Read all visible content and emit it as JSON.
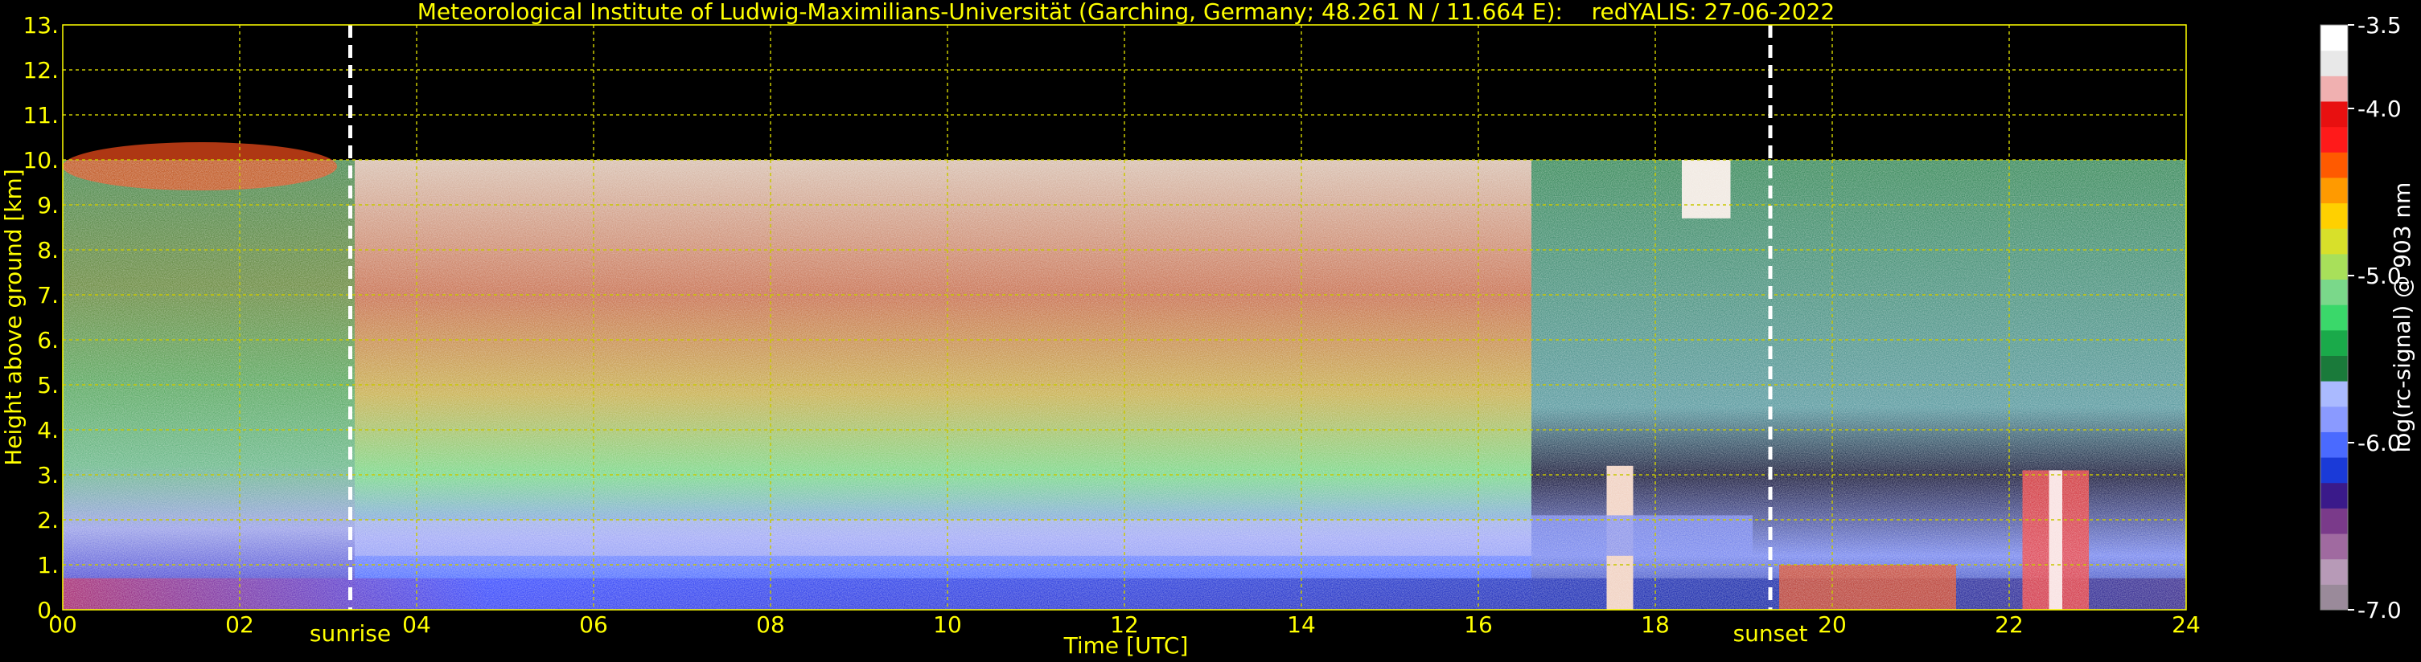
{
  "chart_data": {
    "type": "heatmap",
    "title": "Meteorological Institute of Ludwig-Maximilians-Universität (Garching, Germany; 48.261 N / 11.664 E):    redYALIS: 27-06-2022",
    "xlabel": "Time [UTC]",
    "ylabel": "Height above ground [km]",
    "xlim": [
      0,
      24
    ],
    "ylim": [
      0,
      13
    ],
    "x_ticks": [
      0,
      2,
      4,
      6,
      8,
      10,
      12,
      14,
      16,
      18,
      20,
      22,
      24
    ],
    "x_tick_labels": [
      "00",
      "02",
      "04",
      "06",
      "08",
      "10",
      "12",
      "14",
      "16",
      "18",
      "20",
      "22",
      "24"
    ],
    "y_ticks": [
      0,
      1,
      2,
      3,
      4,
      5,
      6,
      7,
      8,
      9,
      10,
      11,
      12,
      13
    ],
    "y_tick_labels": [
      "0.",
      "1.",
      "2.",
      "3.",
      "4.",
      "5.",
      "6.",
      "7.",
      "8.",
      "9.",
      "10.",
      "11.",
      "12.",
      "13."
    ],
    "grid": true,
    "grid_color": "#c8c800",
    "data_top_km": 10,
    "markers": [
      {
        "label": "sunrise",
        "x": 3.25
      },
      {
        "label": "sunset",
        "x": 19.3
      }
    ],
    "colorbar": {
      "label": "log(rc-signal) @ 903 nm",
      "range": [
        -7.0,
        -3.5
      ],
      "ticks": [
        -3.5,
        -4.0,
        -5.0,
        -6.0,
        -7.0
      ],
      "tick_labels": [
        "-3.5",
        "-4.0",
        "-5.0",
        "-6.0",
        "-7.0"
      ],
      "colors": [
        "#9a8a9a",
        "#b79ab7",
        "#a06aa0",
        "#7a3a8a",
        "#3a1a8a",
        "#1a3ad8",
        "#4a6aff",
        "#8a9aff",
        "#aabaff",
        "#1a7a3a",
        "#1aaa4a",
        "#3ad86a",
        "#7ad88a",
        "#a8e05a",
        "#d8e02a",
        "#ffd000",
        "#ff9a00",
        "#ff5a00",
        "#ff1a1a",
        "#e81010",
        "#f0b0b0",
        "#e8e8e8",
        "#ffffff"
      ]
    }
  }
}
